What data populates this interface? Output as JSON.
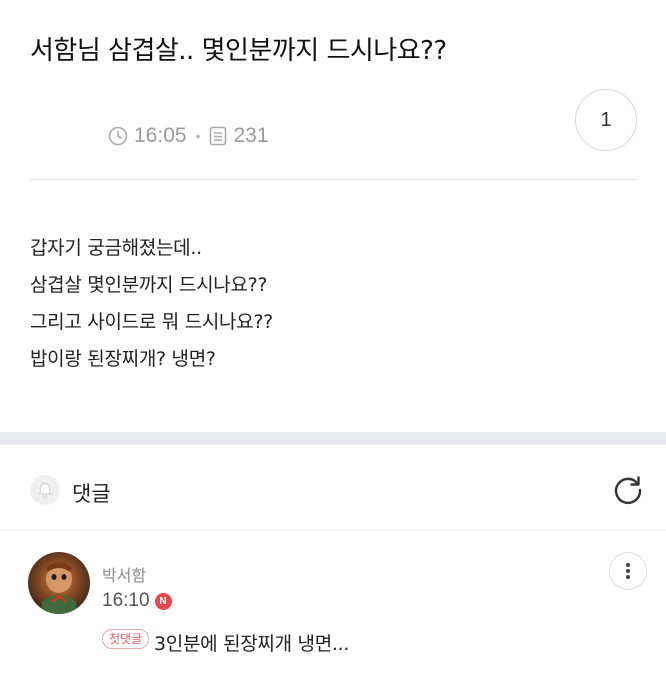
{
  "post": {
    "title": "서함님 삼겹살.. 몇인분까지 드시나요??",
    "time": "16:05",
    "views": "231",
    "comment_count": "1",
    "body_lines": [
      "갑자기 궁금해졌는데..",
      "삼겹살 몇인분까지 드시나요??",
      "그리고 사이드로 뭐 드시나요??",
      "밥이랑 된장찌개? 냉면?"
    ]
  },
  "comments_section": {
    "label": "댓글",
    "icons": {
      "bell": "bell-icon",
      "refresh": "refresh-icon"
    }
  },
  "comments": [
    {
      "author": "박서함",
      "time": "16:10",
      "new_badge": "N",
      "first_badge": "첫댓글",
      "text": "3인분에 된장찌개 냉면..."
    }
  ],
  "colors": {
    "band": "#e9eaee",
    "new_badge": "#e8484d",
    "first_badge": "#e35b60",
    "meta_text": "#9a9a9a"
  }
}
